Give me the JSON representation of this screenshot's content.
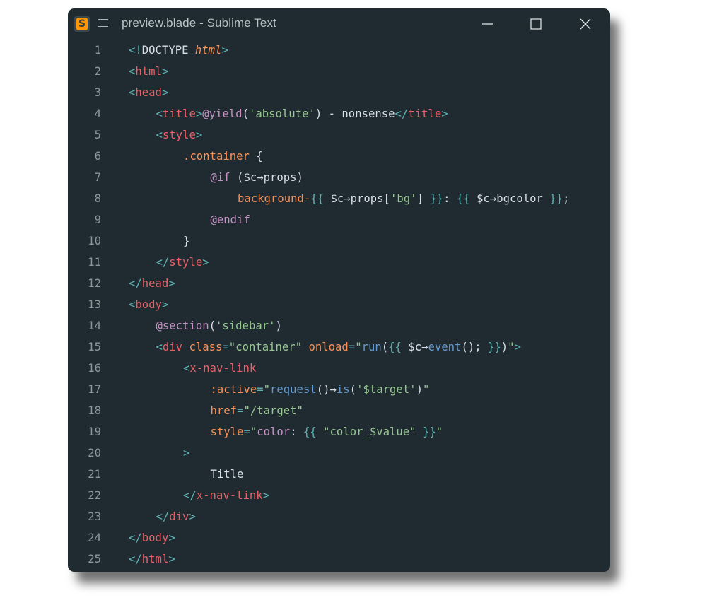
{
  "window": {
    "title": "preview.blade - Sublime Text",
    "app_icon": "sublime-text-logo",
    "colors": {
      "background": "#1f2b30",
      "line_numbers": "#8a979c",
      "tag": "#ec5f67",
      "punctuation": "#5fb3b3",
      "attribute": "#f99157",
      "string": "#99c794",
      "directive": "#c594c5",
      "function": "#6699cc",
      "text": "#d8dee9"
    }
  },
  "controls": {
    "minimize": "minimize-icon",
    "maximize": "maximize-icon",
    "close": "close-icon"
  },
  "editor": {
    "lines": [
      {
        "n": "1",
        "indent": 0,
        "tokens": [
          [
            "punc",
            "<!"
          ],
          [
            "plain",
            "DOCTYPE "
          ],
          [
            "it",
            "html"
          ],
          [
            "punc",
            ">"
          ]
        ]
      },
      {
        "n": "2",
        "indent": 0,
        "tokens": [
          [
            "punc",
            "<"
          ],
          [
            "tag",
            "html"
          ],
          [
            "punc",
            ">"
          ]
        ]
      },
      {
        "n": "3",
        "indent": 0,
        "tokens": [
          [
            "punc",
            "<"
          ],
          [
            "tag",
            "head"
          ],
          [
            "punc",
            ">"
          ]
        ]
      },
      {
        "n": "4",
        "indent": 1,
        "tokens": [
          [
            "punc",
            "<"
          ],
          [
            "tag",
            "title"
          ],
          [
            "punc",
            ">"
          ],
          [
            "kw",
            "@yield"
          ],
          [
            "plain",
            "("
          ],
          [
            "str",
            "'absolute'"
          ],
          [
            "plain",
            ") - nonsense"
          ],
          [
            "punc",
            "</"
          ],
          [
            "tag",
            "title"
          ],
          [
            "punc",
            ">"
          ]
        ]
      },
      {
        "n": "5",
        "indent": 1,
        "tokens": [
          [
            "punc",
            "<"
          ],
          [
            "tag",
            "style"
          ],
          [
            "punc",
            ">"
          ]
        ]
      },
      {
        "n": "6",
        "indent": 2,
        "tokens": [
          [
            "class",
            ".container"
          ],
          [
            "plain",
            " {"
          ]
        ]
      },
      {
        "n": "7",
        "indent": 3,
        "tokens": [
          [
            "kw",
            "@if"
          ],
          [
            "plain",
            " ($c→props)"
          ]
        ]
      },
      {
        "n": "8",
        "indent": 4,
        "tokens": [
          [
            "attr",
            "background-"
          ],
          [
            "punc",
            "{{"
          ],
          [
            "plain",
            " $c→props["
          ],
          [
            "str",
            "'bg'"
          ],
          [
            "plain",
            "] "
          ],
          [
            "punc",
            "}}"
          ],
          [
            "plain",
            ": "
          ],
          [
            "punc",
            "{{"
          ],
          [
            "plain",
            " $c→bgcolor "
          ],
          [
            "punc",
            "}}"
          ],
          [
            "plain",
            ";"
          ]
        ]
      },
      {
        "n": "9",
        "indent": 3,
        "tokens": [
          [
            "kw",
            "@endif"
          ]
        ]
      },
      {
        "n": "10",
        "indent": 2,
        "tokens": [
          [
            "plain",
            "}"
          ]
        ]
      },
      {
        "n": "11",
        "indent": 1,
        "tokens": [
          [
            "punc",
            "</"
          ],
          [
            "tag",
            "style"
          ],
          [
            "punc",
            ">"
          ]
        ]
      },
      {
        "n": "12",
        "indent": 0,
        "tokens": [
          [
            "punc",
            "</"
          ],
          [
            "tag",
            "head"
          ],
          [
            "punc",
            ">"
          ]
        ]
      },
      {
        "n": "13",
        "indent": 0,
        "tokens": [
          [
            "punc",
            "<"
          ],
          [
            "tag",
            "body"
          ],
          [
            "punc",
            ">"
          ]
        ]
      },
      {
        "n": "14",
        "indent": 1,
        "tokens": [
          [
            "kw",
            "@section"
          ],
          [
            "plain",
            "("
          ],
          [
            "str",
            "'sidebar'"
          ],
          [
            "plain",
            ")"
          ]
        ]
      },
      {
        "n": "15",
        "indent": 1,
        "tokens": [
          [
            "punc",
            "<"
          ],
          [
            "tag",
            "div"
          ],
          [
            "attr",
            " class"
          ],
          [
            "punc",
            "="
          ],
          [
            "str",
            "\"container\""
          ],
          [
            "attr",
            " onload"
          ],
          [
            "punc",
            "="
          ],
          [
            "str",
            "\""
          ],
          [
            "fn",
            "run"
          ],
          [
            "plain",
            "("
          ],
          [
            "punc",
            "{{"
          ],
          [
            "plain",
            " $c→"
          ],
          [
            "fn",
            "event"
          ],
          [
            "plain",
            "(); "
          ],
          [
            "punc",
            "}}"
          ],
          [
            "plain",
            ")"
          ],
          [
            "str",
            "\""
          ],
          [
            "punc",
            ">"
          ]
        ]
      },
      {
        "n": "16",
        "indent": 2,
        "tokens": [
          [
            "punc",
            "<"
          ],
          [
            "tag",
            "x-nav-link"
          ]
        ]
      },
      {
        "n": "17",
        "indent": 3,
        "tokens": [
          [
            "attr",
            ":active"
          ],
          [
            "punc",
            "="
          ],
          [
            "str",
            "\""
          ],
          [
            "fn",
            "request"
          ],
          [
            "plain",
            "()→"
          ],
          [
            "fn",
            "is"
          ],
          [
            "plain",
            "("
          ],
          [
            "str",
            "'$target'"
          ],
          [
            "plain",
            ")"
          ],
          [
            "str",
            "\""
          ]
        ]
      },
      {
        "n": "18",
        "indent": 3,
        "tokens": [
          [
            "attr",
            "href"
          ],
          [
            "punc",
            "="
          ],
          [
            "str",
            "\"/target\""
          ]
        ]
      },
      {
        "n": "19",
        "indent": 3,
        "tokens": [
          [
            "attr",
            "style"
          ],
          [
            "punc",
            "="
          ],
          [
            "str",
            "\""
          ],
          [
            "kw",
            "color"
          ],
          [
            "plain",
            ": "
          ],
          [
            "punc",
            "{{"
          ],
          [
            "str",
            " \"color_$value\" "
          ],
          [
            "punc",
            "}}"
          ],
          [
            "str",
            "\""
          ]
        ]
      },
      {
        "n": "20",
        "indent": 2,
        "tokens": [
          [
            "punc",
            ">"
          ]
        ]
      },
      {
        "n": "21",
        "indent": 3,
        "tokens": [
          [
            "plain",
            "Title"
          ]
        ]
      },
      {
        "n": "22",
        "indent": 2,
        "tokens": [
          [
            "punc",
            "</"
          ],
          [
            "tag",
            "x-nav-link"
          ],
          [
            "punc",
            ">"
          ]
        ]
      },
      {
        "n": "23",
        "indent": 1,
        "tokens": [
          [
            "punc",
            "</"
          ],
          [
            "tag",
            "div"
          ],
          [
            "punc",
            ">"
          ]
        ]
      },
      {
        "n": "24",
        "indent": 0,
        "tokens": [
          [
            "punc",
            "</"
          ],
          [
            "tag",
            "body"
          ],
          [
            "punc",
            ">"
          ]
        ]
      },
      {
        "n": "25",
        "indent": 0,
        "tokens": [
          [
            "punc",
            "</"
          ],
          [
            "tag",
            "html"
          ],
          [
            "punc",
            ">"
          ]
        ]
      }
    ]
  }
}
